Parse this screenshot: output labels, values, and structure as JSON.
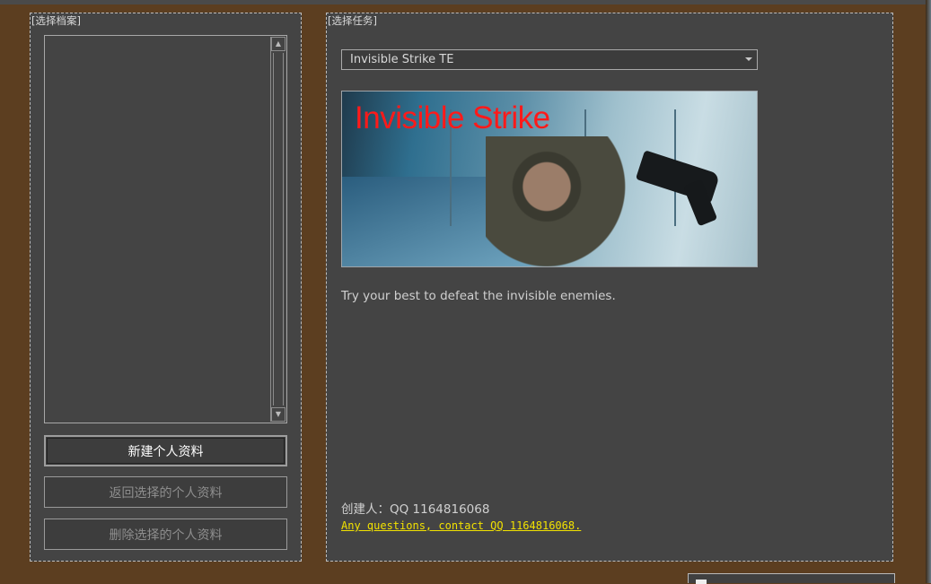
{
  "profiles": {
    "title": "[选择档案]",
    "items": [],
    "buttons": {
      "new": "新建个人资料",
      "back": "返回选择的个人资料",
      "delete": "删除选择的个人资料"
    }
  },
  "missions": {
    "title": "[选择任务]",
    "selected": "Invisible Strike TE",
    "banner_title": "Invisible Strike",
    "description": "Try your best to defeat the invisible enemies.",
    "creator": "创建人：QQ 1164816068",
    "contact": "Any questions, contact QQ 1164816068."
  },
  "icons": {
    "scroll_up": "arrow-up-icon",
    "scroll_down": "arrow-down-icon",
    "dropdown": "chevron-down-icon"
  },
  "colors": {
    "background": "#5c3e20",
    "panel": "#444444",
    "link": "#f2e200",
    "banner_title": "#ff1a1a"
  }
}
